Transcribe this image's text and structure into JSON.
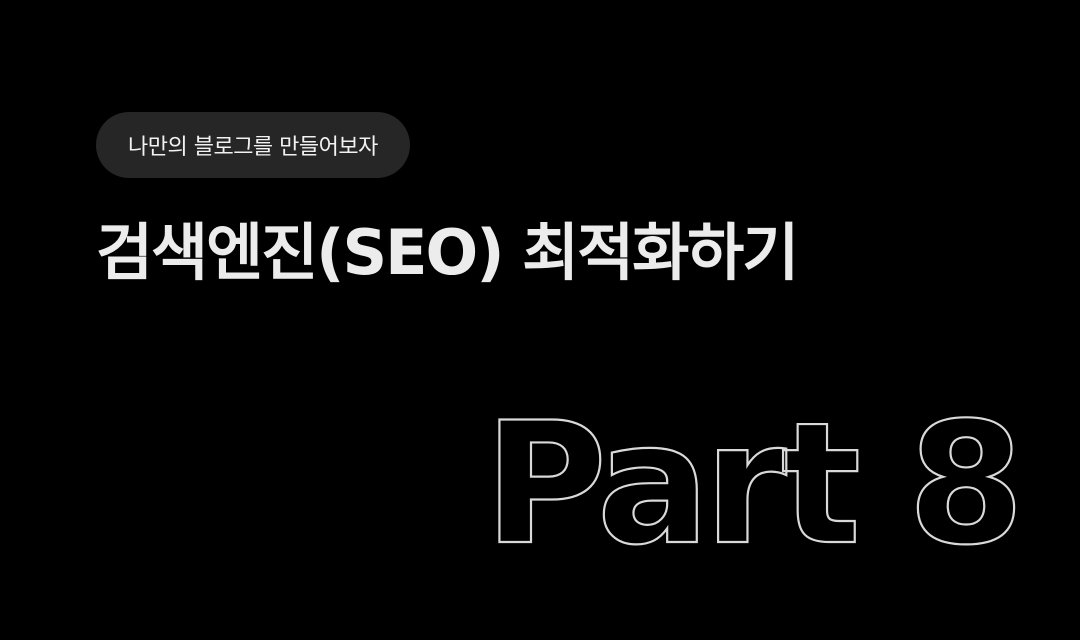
{
  "badge": {
    "label": "나만의 블로그를 만들어보자"
  },
  "heading": {
    "title": "검색엔진(SEO) 최적화하기"
  },
  "outline": {
    "text": "Part 8"
  },
  "colors": {
    "background": "#000000",
    "pill_background": "#262626",
    "text": "#ececec",
    "outline_stroke": "#d9d9d9"
  }
}
